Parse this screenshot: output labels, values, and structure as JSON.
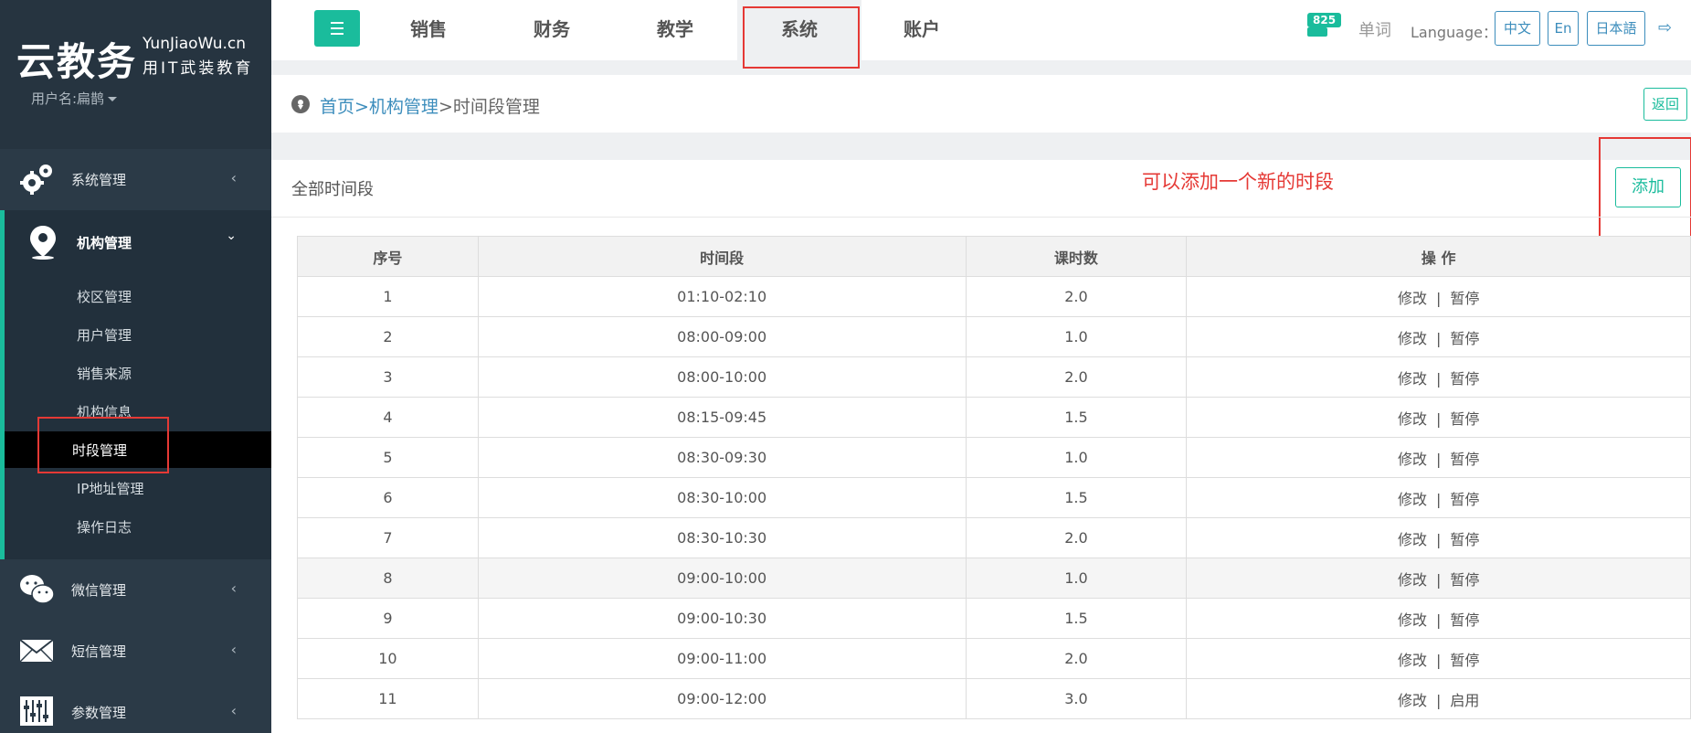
{
  "sidebar": {
    "logo_main": "云教务",
    "logo_domain": "YunJiaoWu.cn",
    "logo_slogan": "用IT武装教育",
    "user_label": "用户名:扁鹊",
    "groups": [
      {
        "label": "系统管理",
        "icon": "gears-icon"
      },
      {
        "label": "机构管理",
        "icon": "map-marker-icon"
      },
      {
        "label": "微信管理",
        "icon": "wechat-icon"
      },
      {
        "label": "短信管理",
        "icon": "envelope-icon"
      },
      {
        "label": "参数管理",
        "icon": "sliders-icon"
      }
    ],
    "org_items": [
      "校区管理",
      "用户管理",
      "销售来源",
      "机构信息",
      "时段管理",
      "IP地址管理",
      "操作日志"
    ]
  },
  "topbar": {
    "tabs": [
      "销售",
      "财务",
      "教学",
      "系统",
      "账户"
    ],
    "active_tab": "系统",
    "badge": "825",
    "words": "单词",
    "language_label": "Language：",
    "languages": [
      "中文",
      "En",
      "日本語"
    ]
  },
  "breadcrumb": {
    "home": "首页",
    "parent": ">机构管理",
    "current": ">时间段管理",
    "back": "返回"
  },
  "panel": {
    "title": "全部时间段",
    "hint": "可以添加一个新的时段",
    "add_button": "添加"
  },
  "table": {
    "headers": [
      "序号",
      "时间段",
      "课时数",
      "操 作"
    ],
    "rows": [
      {
        "no": "1",
        "period": "01:10-02:10",
        "hours": "2.0",
        "edit": "修改",
        "toggle": "暂停"
      },
      {
        "no": "2",
        "period": "08:00-09:00",
        "hours": "1.0",
        "edit": "修改",
        "toggle": "暂停"
      },
      {
        "no": "3",
        "period": "08:00-10:00",
        "hours": "2.0",
        "edit": "修改",
        "toggle": "暂停"
      },
      {
        "no": "4",
        "period": "08:15-09:45",
        "hours": "1.5",
        "edit": "修改",
        "toggle": "暂停"
      },
      {
        "no": "5",
        "period": "08:30-09:30",
        "hours": "1.0",
        "edit": "修改",
        "toggle": "暂停"
      },
      {
        "no": "6",
        "period": "08:30-10:00",
        "hours": "1.5",
        "edit": "修改",
        "toggle": "暂停"
      },
      {
        "no": "7",
        "period": "08:30-10:30",
        "hours": "2.0",
        "edit": "修改",
        "toggle": "暂停"
      },
      {
        "no": "8",
        "period": "09:00-10:00",
        "hours": "1.0",
        "edit": "修改",
        "toggle": "暂停"
      },
      {
        "no": "9",
        "period": "09:00-10:30",
        "hours": "1.5",
        "edit": "修改",
        "toggle": "暂停"
      },
      {
        "no": "10",
        "period": "09:00-11:00",
        "hours": "2.0",
        "edit": "修改",
        "toggle": "暂停"
      },
      {
        "no": "11",
        "period": "09:00-12:00",
        "hours": "3.0",
        "edit": "修改",
        "toggle": "启用"
      }
    ]
  },
  "colors": {
    "accent": "#1abc9c",
    "link": "#3c8dbc",
    "sidebar": "#2b3a47",
    "annotation": "#e53935"
  }
}
